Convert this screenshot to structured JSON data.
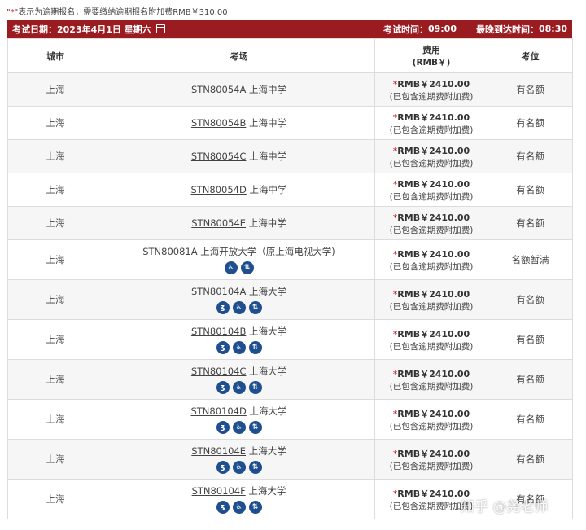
{
  "note": {
    "star": "\"*\"",
    "text": "表示为逾期报名，需要缴纳逾期报名附加费RMB￥310.00"
  },
  "datebar": {
    "exam_date_label": "考试日期：",
    "exam_date": "2023年4月1日 星期六",
    "exam_time_label": "考试时间：",
    "exam_time": "09:00",
    "arrive_label": "最晚到达时间：",
    "arrive_time": "08:30"
  },
  "table": {
    "headers": {
      "city": "城市",
      "venue": "考场",
      "fee": "费用",
      "fee_sub": "(RMB￥)",
      "seat": "考位"
    },
    "rows": [
      {
        "city": "上海",
        "code": "STN80054A",
        "venue": "上海中学",
        "fee": "RMB￥2410.00",
        "fee_note": "(已包含逾期费附加费)",
        "seat": "有名额",
        "icons": []
      },
      {
        "city": "上海",
        "code": "STN80054B",
        "venue": "上海中学",
        "fee": "RMB￥2410.00",
        "fee_note": "(已包含逾期费附加费)",
        "seat": "有名额",
        "icons": []
      },
      {
        "city": "上海",
        "code": "STN80054C",
        "venue": "上海中学",
        "fee": "RMB￥2410.00",
        "fee_note": "(已包含逾期费附加费)",
        "seat": "有名额",
        "icons": []
      },
      {
        "city": "上海",
        "code": "STN80054D",
        "venue": "上海中学",
        "fee": "RMB￥2410.00",
        "fee_note": "(已包含逾期费附加费)",
        "seat": "有名额",
        "icons": []
      },
      {
        "city": "上海",
        "code": "STN80054E",
        "venue": "上海中学",
        "fee": "RMB￥2410.00",
        "fee_note": "(已包含逾期费附加费)",
        "seat": "有名额",
        "icons": []
      },
      {
        "city": "上海",
        "code": "STN80081A",
        "venue": "上海开放大学（原上海电视大学)",
        "fee": "RMB￥2410.00",
        "fee_note": "(已包含逾期费附加费)",
        "seat": "名额暂满",
        "icons": [
          "wheelchair-icon",
          "elevator-icon"
        ]
      },
      {
        "city": "上海",
        "code": "STN80104A",
        "venue": "上海大学",
        "fee": "RMB￥2410.00",
        "fee_note": "(已包含逾期费附加费)",
        "seat": "有名额",
        "icons": [
          "hearing-icon",
          "wheelchair-icon",
          "elevator-icon"
        ]
      },
      {
        "city": "上海",
        "code": "STN80104B",
        "venue": "上海大学",
        "fee": "RMB￥2410.00",
        "fee_note": "(已包含逾期费附加费)",
        "seat": "有名额",
        "icons": [
          "hearing-icon",
          "wheelchair-icon",
          "elevator-icon"
        ]
      },
      {
        "city": "上海",
        "code": "STN80104C",
        "venue": "上海大学",
        "fee": "RMB￥2410.00",
        "fee_note": "(已包含逾期费附加费)",
        "seat": "有名额",
        "icons": [
          "hearing-icon",
          "wheelchair-icon",
          "elevator-icon"
        ]
      },
      {
        "city": "上海",
        "code": "STN80104D",
        "venue": "上海大学",
        "fee": "RMB￥2410.00",
        "fee_note": "(已包含逾期费附加费)",
        "seat": "有名额",
        "icons": [
          "hearing-icon",
          "wheelchair-icon",
          "elevator-icon"
        ]
      },
      {
        "city": "上海",
        "code": "STN80104E",
        "venue": "上海大学",
        "fee": "RMB￥2410.00",
        "fee_note": "(已包含逾期费附加费)",
        "seat": "有名额",
        "icons": [
          "hearing-icon",
          "wheelchair-icon",
          "elevator-icon"
        ]
      },
      {
        "city": "上海",
        "code": "STN80104F",
        "venue": "上海大学",
        "fee": "RMB￥2410.00",
        "fee_note": "(已包含逾期费附加费)",
        "seat": "有名额",
        "icons": [
          "hearing-icon",
          "wheelchair-icon",
          "elevator-icon"
        ]
      }
    ]
  },
  "watermark": "知乎 @尧老师",
  "colors": {
    "header_bar": "#9a1b20",
    "icon_badge": "#1f4f8f",
    "late_asterisk": "#c0141b"
  }
}
